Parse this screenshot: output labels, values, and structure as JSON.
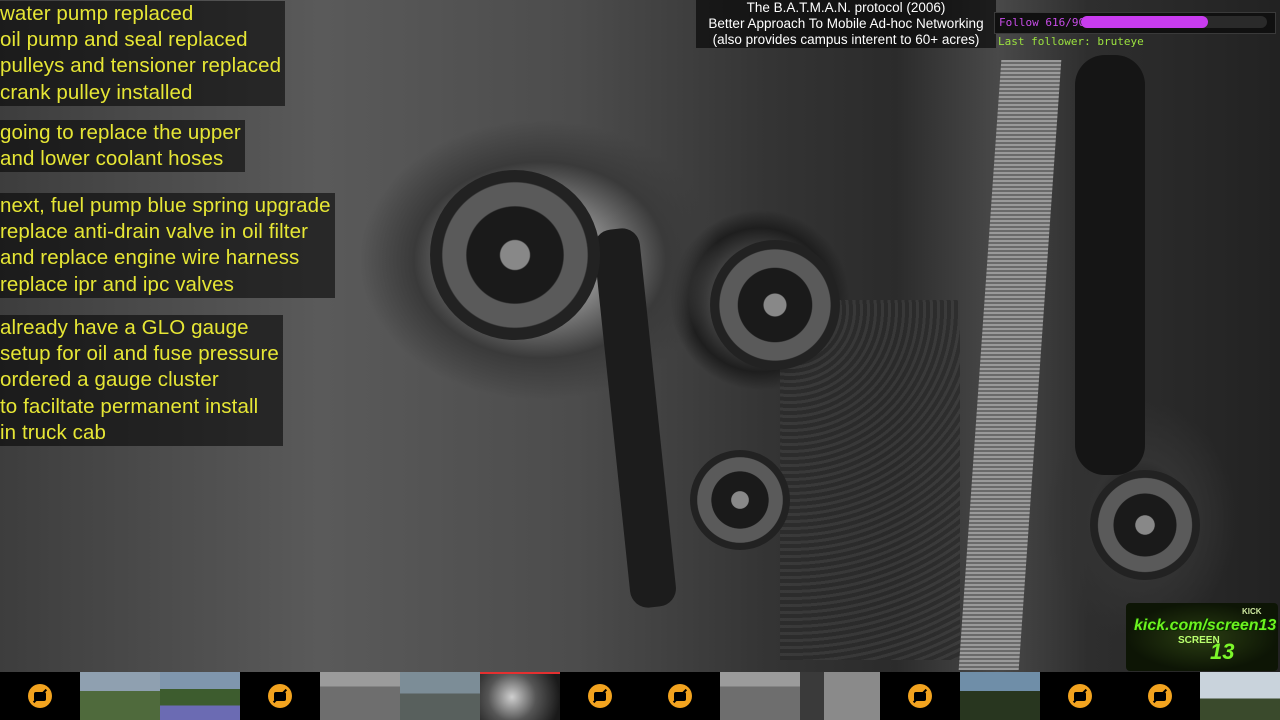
{
  "overlay_notes": {
    "block1": [
      "water pump replaced",
      "oil pump and seal replaced",
      "pulleys and tensioner replaced",
      "crank pulley installed"
    ],
    "block2": [
      "going to replace the upper",
      "and lower coolant hoses"
    ],
    "block3": [
      "next, fuel pump blue spring upgrade",
      "replace anti-drain valve in oil filter",
      "and replace engine wire harness",
      "replace ipr and ipc valves"
    ],
    "block4": [
      "already have a GLO gauge",
      "setup for oil and fuse pressure",
      "ordered a gauge cluster",
      "to faciltate permanent install",
      "in truck cab"
    ]
  },
  "header": {
    "protocol_line1": "The B.A.T.M.A.N. protocol (2006)",
    "protocol_line2": "Better Approach To Mobile Ad-hoc Networking",
    "protocol_line3": "(also provides campus interent to 60+ acres)"
  },
  "follow_goal": {
    "label": "Follow 616/900",
    "current": 616,
    "target": 900,
    "fraction": 0.6844,
    "color": "#c93cf0"
  },
  "last_follower": {
    "text": "Last follower: bruteye"
  },
  "kick_logo": {
    "small": "KICK",
    "url": "kick.com/screen13",
    "screen": "SCREEN",
    "number": "13"
  },
  "thumbnails": [
    {
      "type": "off",
      "icon": "camera-off-icon"
    },
    {
      "type": "feed",
      "scene": "landscape-road"
    },
    {
      "type": "feed",
      "scene": "landscape-field"
    },
    {
      "type": "off",
      "icon": "camera-off-icon"
    },
    {
      "type": "feed",
      "scene": "yard-gray"
    },
    {
      "type": "feed",
      "scene": "street-cars"
    },
    {
      "type": "feed",
      "scene": "engine-bw",
      "active": true
    },
    {
      "type": "off",
      "icon": "camera-off-icon"
    },
    {
      "type": "off",
      "icon": "camera-off-icon"
    },
    {
      "type": "feed",
      "scene": "yard-gray"
    },
    {
      "type": "feed",
      "scene": "porch"
    },
    {
      "type": "off",
      "icon": "camera-off-icon"
    },
    {
      "type": "feed",
      "scene": "trees-dark"
    },
    {
      "type": "off",
      "icon": "camera-off-icon"
    },
    {
      "type": "off",
      "icon": "camera-off-icon"
    },
    {
      "type": "feed",
      "scene": "sky-trees"
    }
  ]
}
